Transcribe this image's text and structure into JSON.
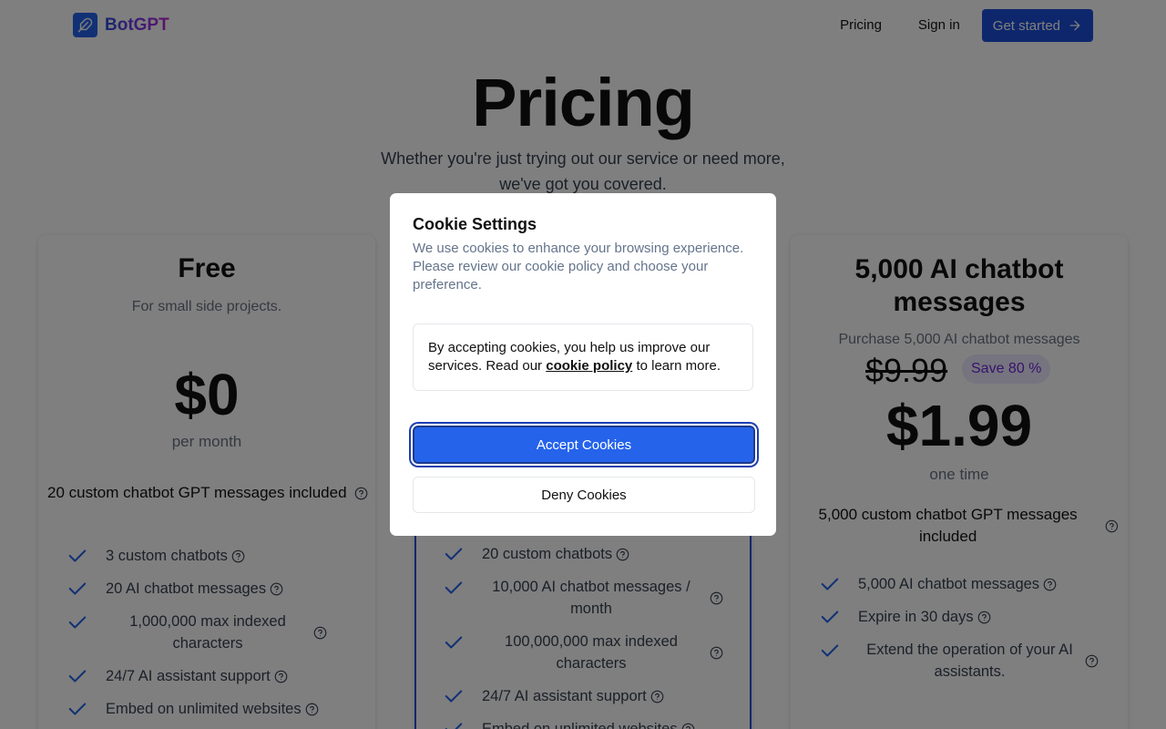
{
  "header": {
    "brand": "BotGPT",
    "nav": {
      "pricing": "Pricing",
      "signin": "Sign in",
      "cta": "Get started"
    }
  },
  "hero": {
    "title": "Pricing",
    "subtitle_line1": "Whether you're just trying out our service or need more,",
    "subtitle_line2": "we've got you covered."
  },
  "plans": [
    {
      "title": "Free",
      "description": "For small side projects.",
      "price": "$0",
      "period": "per month",
      "included": "20 custom chatbot GPT messages included",
      "features": [
        {
          "text": "3 custom chatbots"
        },
        {
          "text": "20 AI chatbot messages"
        },
        {
          "text_line1": "1,000,000 max indexed",
          "text_line2": "characters"
        },
        {
          "text": "24/7 AI assistant support"
        },
        {
          "text": "Embed on unlimited websites"
        }
      ]
    },
    {
      "features": [
        {
          "text": "20 custom chatbots"
        },
        {
          "text_line1": "10,000 AI chatbot messages /",
          "text_line2": "month"
        },
        {
          "text_line1": "100,000,000 max indexed",
          "text_line2": "characters"
        },
        {
          "text": "24/7 AI assistant support"
        },
        {
          "text": "Embed on unlimited websites"
        }
      ]
    },
    {
      "title_line1": "5,000 AI chatbot",
      "title_line2": "messages",
      "description": "Purchase 5,000 AI chatbot messages",
      "old_price": "$9.99",
      "save_badge": "Save 80 %",
      "price": "$1.99",
      "period": "one time",
      "included_line1": "5,000 custom chatbot GPT messages",
      "included_line2": "included",
      "features": [
        {
          "text": "5,000 AI chatbot messages"
        },
        {
          "text": "Expire in 30 days"
        },
        {
          "text_line1": "Extend the operation of your AI",
          "text_line2": "assistants."
        }
      ]
    }
  ],
  "modal": {
    "title": "Cookie Settings",
    "description": "We use cookies to enhance your browsing experience. Please review our cookie policy and choose your preference.",
    "policy_text_before": "By accepting cookies, you help us improve our services. Read our ",
    "policy_link": "cookie policy",
    "policy_text_after": " to learn more.",
    "accept_label": "Accept Cookies",
    "deny_label": "Deny Cookies"
  },
  "colors": {
    "accent": "#2563eb",
    "accent_dark": "#1d4ed8",
    "badge_bg": "#ede9fe",
    "badge_text": "#6d28d9",
    "overlay": "rgba(0,0,0,0.5)"
  },
  "icons": {
    "logo": "feather-icon",
    "cta_arrow": "arrow-right-icon",
    "feature_check": "check-icon",
    "help": "help-circle-icon"
  }
}
